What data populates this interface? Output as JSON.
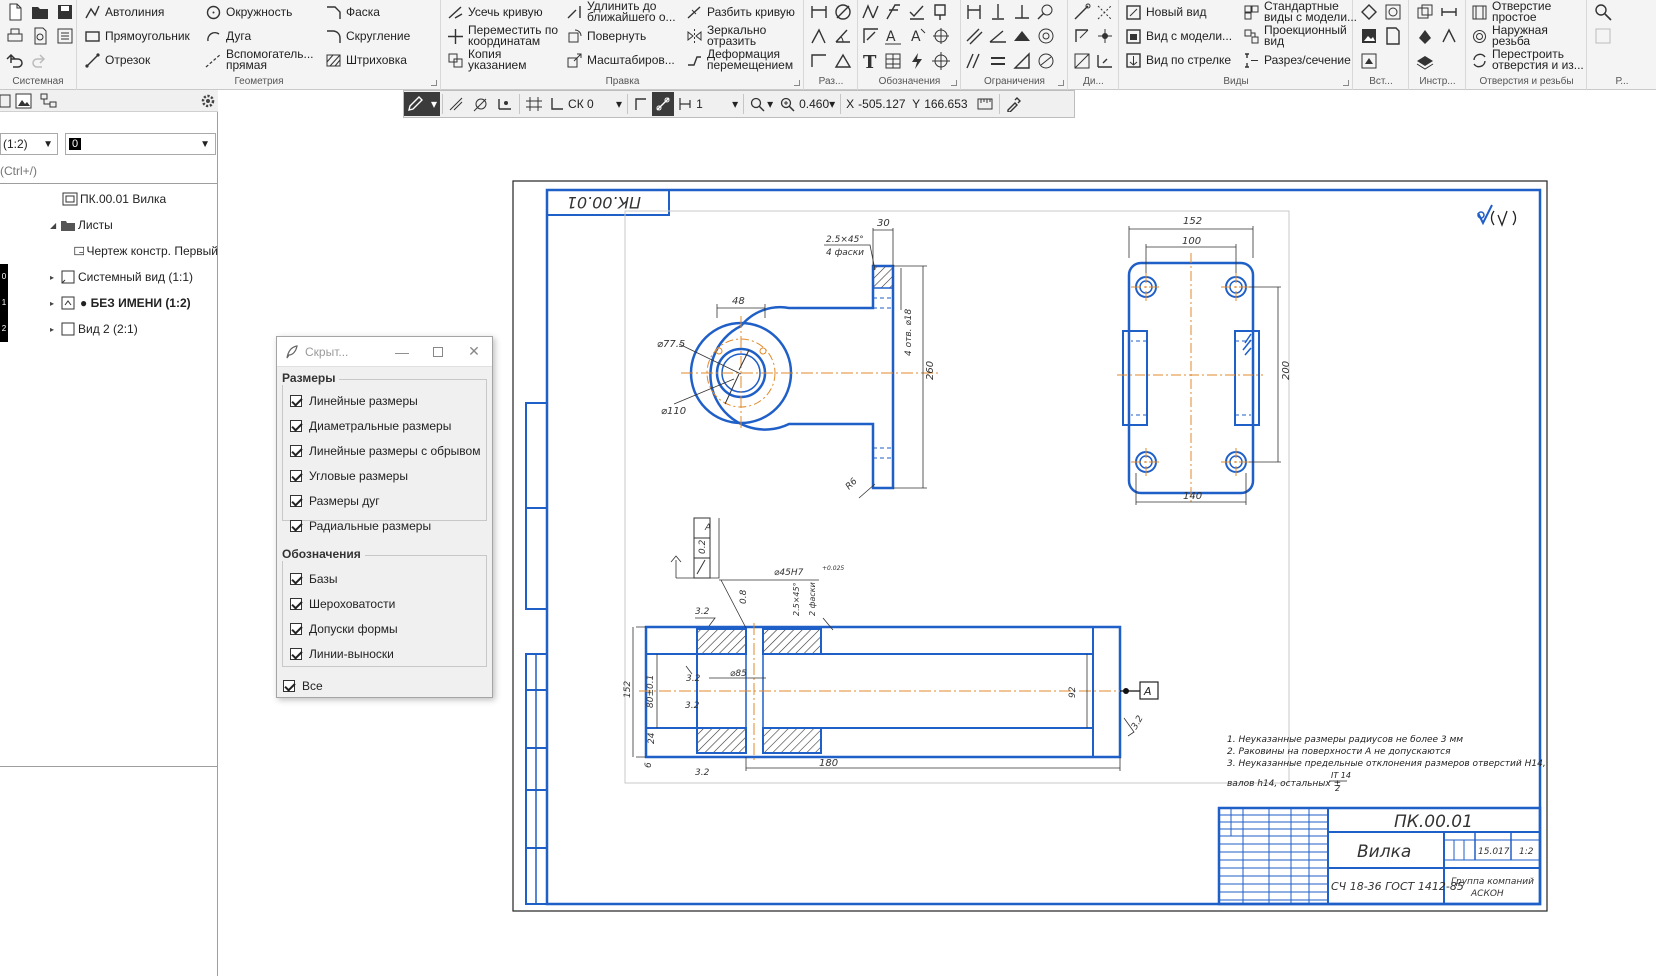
{
  "ribbon": {
    "groups": [
      {
        "label": "Системная"
      },
      {
        "label": "Геометрия"
      },
      {
        "label": "Правка"
      },
      {
        "label": "Раз..."
      },
      {
        "label": "Обозначения"
      },
      {
        "label": "Ограничения"
      },
      {
        "label": "Ди..."
      },
      {
        "label": "Виды"
      },
      {
        "label": "Вст..."
      },
      {
        "label": "Инстр..."
      },
      {
        "label": "Отверстия и резьбы"
      },
      {
        "label": "Р..."
      }
    ],
    "geometry": {
      "autoline": "Автолиния",
      "rectangle": "Прямоугольник",
      "segment": "Отрезок",
      "circle": "Окружность",
      "arc": "Дуга",
      "aux_line_1": "Вспомогатель...",
      "aux_line_2": "прямая",
      "chamfer": "Фаска",
      "fillet": "Скругление",
      "hatch": "Штриховка"
    },
    "edit": {
      "trim": "Усечь кривую",
      "move_coords_1": "Переместить по",
      "move_coords_2": "координатам",
      "copy_1": "Копия",
      "copy_2": "указанием",
      "extend_1": "Удлинить до",
      "extend_2": "ближайшего о...",
      "rotate": "Повернуть",
      "scale": "Масштабиров...",
      "split": "Разбить кривую",
      "mirror_1": "Зеркально",
      "mirror_2": "отразить",
      "deform_1": "Деформация",
      "deform_2": "перемещением"
    },
    "views": {
      "new_view": "Новый вид",
      "view_from_model": "Вид с модели...",
      "arrow_view": "Вид по стрелке",
      "standard_1": "Стандартные",
      "standard_2": "виды с модели...",
      "projection_1": "Проекционный",
      "projection_2": "вид",
      "section": "Разрез/сечение"
    },
    "holes": {
      "simple_1": "Отверстие",
      "simple_2": "простое",
      "thread_1": "Наружная",
      "thread_2": "резьба",
      "rebuild_1": "Перестроить",
      "rebuild_2": "отверстия и из..."
    }
  },
  "toolbar2": {
    "cs": "СК 0",
    "step": "1",
    "zoom": "0.460",
    "x_label": "X",
    "x_value": "-505.127",
    "y_label": "Y",
    "y_value": "166.653"
  },
  "leftpanel": {
    "scale_select": "(1:2)",
    "layer_value": "0",
    "search_placeholder": "(Ctrl+/)",
    "tree": [
      {
        "label": "ПК.00.01 Вилка",
        "mark": ""
      },
      {
        "label": "Листы",
        "mark": ""
      },
      {
        "label": "Чертеж констр. Первый",
        "mark": ""
      },
      {
        "label": "Системный вид (1:1)",
        "mark": "0"
      },
      {
        "label": "● БЕЗ ИМЕНИ (1:2)",
        "mark": "1"
      },
      {
        "label": "Вид 2 (2:1)",
        "mark": "2"
      }
    ]
  },
  "dialog": {
    "title": "Скрыт...",
    "group1": "Размеры",
    "g1_items": [
      "Линейные размеры",
      "Диаметральные размеры",
      "Линейные размеры с обрывом",
      "Угловые размеры",
      "Размеры дуг",
      "Радиальные размеры"
    ],
    "group2": "Обозначения",
    "g2_items": [
      "Базы",
      "Шероховатости",
      "Допуски формы",
      "Линии-выноски"
    ],
    "all": "Все"
  },
  "drawing": {
    "stamp_top": "ПК.00.01",
    "designation": "ПК.00.01",
    "part_name": "Вилка",
    "material": "СЧ 18-36 ГОСТ 1412-85",
    "company_1": "Группа компаний",
    "company_2": "АСКОН",
    "mass": "15.017",
    "scale": "1:2",
    "notes": [
      "1. Неуказанные размеры радиусов не более 3 мм",
      "2. Раковины на поверхности А не допускаются",
      "3. Неуказанные предельные отклонения размеров отверстий Н14,",
      "валов h14, остальных ±"
    ],
    "notes_frac_num": "IT 14",
    "notes_frac_den": "2",
    "datum": "А",
    "dims": {
      "top_30": "30",
      "chamfer_1": "2.5×45°",
      "chamfer_2": "4 фаски",
      "d48": "48",
      "d77": "⌀77.5",
      "d110": "⌀110",
      "d18": "4 отв. ⌀18",
      "h260": "260",
      "r16": "R6",
      "w152": "152",
      "w100": "100",
      "h200": "200",
      "w140": "140",
      "tol": "0.2",
      "tolA": "A",
      "hole": "⌀45H7",
      "hole_tol": "+0.025",
      "rough_32": "3.2",
      "rough_08": "0.8",
      "chamfer_3": "2.5×45°",
      "chamfer_4": "2 фаски",
      "d85": "⌀85",
      "h152b": "152",
      "h80": "80±0.1",
      "d92": "92",
      "r32": "3.2",
      "w24": "24",
      "w6": "6",
      "w180": "180"
    }
  }
}
